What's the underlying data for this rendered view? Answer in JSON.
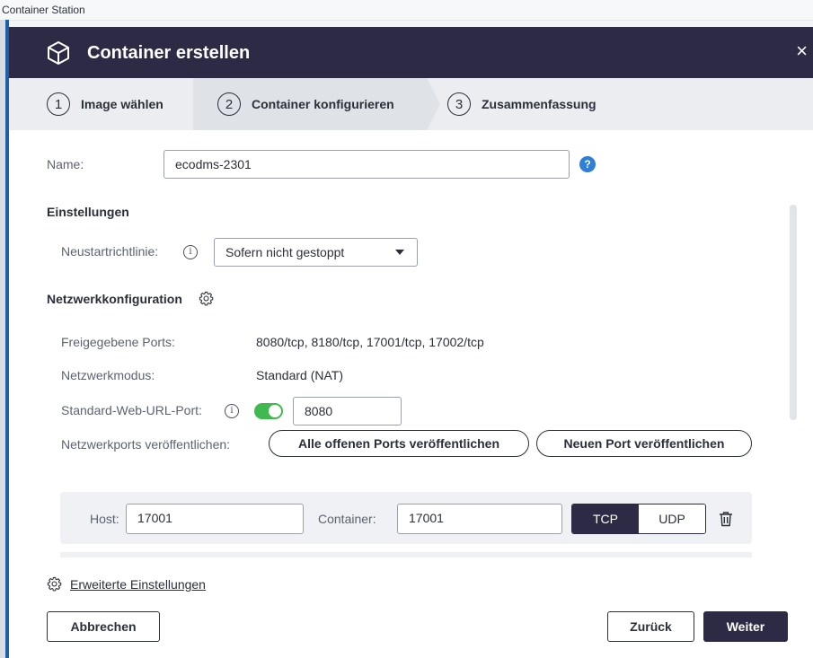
{
  "app": {
    "title": "Container Station"
  },
  "dialog": {
    "title": "Container erstellen",
    "close_label": "×",
    "steps": [
      {
        "num": "1",
        "label": "Image wählen"
      },
      {
        "num": "2",
        "label": "Container konfigurieren"
      },
      {
        "num": "3",
        "label": "Zusammenfassung"
      }
    ]
  },
  "form": {
    "name_label": "Name:",
    "name_value": "ecodms-2301",
    "help_icon": "?",
    "settings_title": "Einstellungen",
    "restart_label": "Neustartrichtlinie:",
    "restart_value": "Sofern nicht gestoppt",
    "network_title": "Netzwerkkonfiguration",
    "published_ports_label": "Freigegebene Ports:",
    "published_ports_value": "8080/tcp, 8180/tcp, 17001/tcp, 17002/tcp",
    "network_mode_label": "Netzwerkmodus:",
    "network_mode_value": "Standard (NAT)",
    "web_url_port_label": "Standard-Web-URL-Port:",
    "web_url_port_enabled": true,
    "web_url_port_value": "8080",
    "publish_ports_label": "Netzwerkports veröffentlichen:",
    "publish_all_button": "Alle offenen Ports veröffentlichen",
    "new_port_button": "Neuen Port veröffentlichen",
    "port_row": {
      "host_label": "Host:",
      "host_value": "17001",
      "container_label": "Container:",
      "container_value": "17001",
      "protocols": [
        "TCP",
        "UDP"
      ],
      "selected_protocol": "TCP"
    },
    "advanced_link": "Erweiterte Einstellungen"
  },
  "footer": {
    "cancel": "Abbrechen",
    "back": "Zurück",
    "next": "Weiter"
  },
  "colors": {
    "header_bg": "#2d2a45",
    "accent_blue": "#1e5fa8",
    "toggle_on": "#3fb950",
    "help_blue": "#2f7ed8"
  }
}
